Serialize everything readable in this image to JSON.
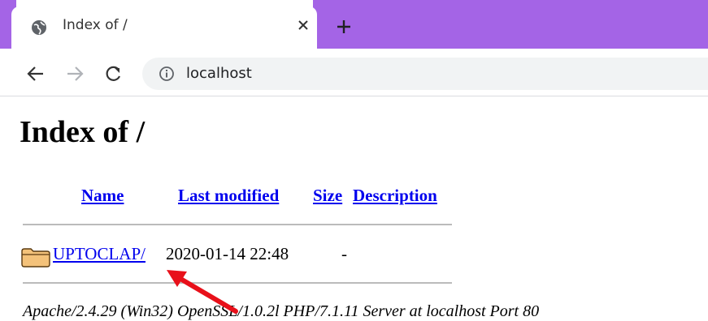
{
  "browser": {
    "tab_title": "Index of /",
    "tab_close": "×",
    "new_tab": "+",
    "url": "localhost",
    "accent_color": "#a464e6"
  },
  "page": {
    "heading": "Index of /",
    "columns": {
      "name": "Name",
      "last_modified": "Last modified",
      "size": "Size",
      "description": "Description"
    },
    "rows": [
      {
        "name": "UPTOCLAP/",
        "last_modified": "2020-01-14 22:48",
        "size": "-",
        "description": ""
      }
    ],
    "footer": "Apache/2.4.29 (Win32) OpenSSL/1.0.2l PHP/7.1.11 Server at localhost Port 80"
  },
  "annotation": {
    "arrow_color": "#e8101a"
  }
}
